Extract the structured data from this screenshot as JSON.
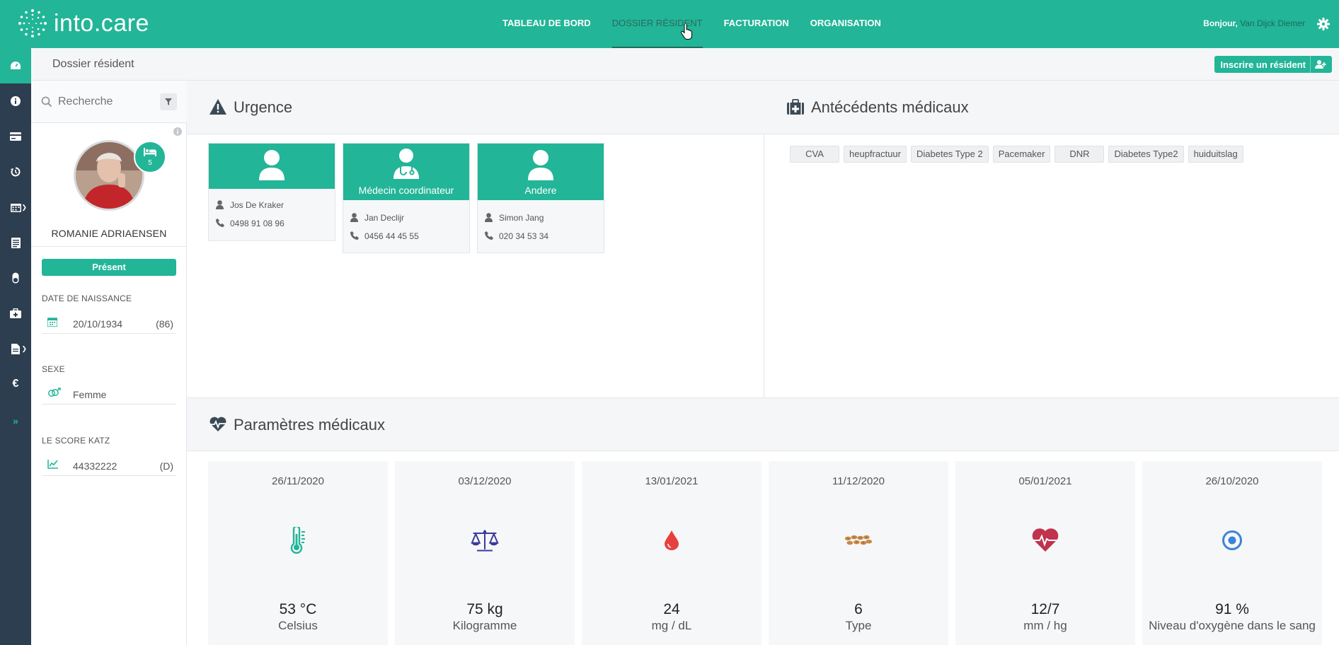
{
  "app": {
    "brand": "into.care"
  },
  "nav": {
    "items": [
      {
        "label": "TABLEAU DE BORD"
      },
      {
        "label": "DOSSIER RÉSIDENT"
      },
      {
        "label": "FACTURATION"
      },
      {
        "label": "ORGANISATION"
      }
    ],
    "greeting": "Bonjour,",
    "user": "Van Dijck Diemer"
  },
  "breadcrumb": {
    "title": "Dossier résident"
  },
  "enroll_button": {
    "label": "Inscrire un résident"
  },
  "search": {
    "placeholder": "Recherche"
  },
  "resident": {
    "bed": "5",
    "name": "ROMANIE ADRIAENSEN",
    "status": "Présent",
    "birth_label": "DATE DE NAISSANCE",
    "birth_date": "20/10/1934",
    "age": "(86)",
    "sex_label": "SEXE",
    "sex": "Femme",
    "katz_label": "LE SCORE KATZ",
    "katz_score": "44332222",
    "katz_class": "(D)"
  },
  "urgence": {
    "title": "Urgence",
    "contacts": [
      {
        "role": "",
        "name": "Jos De Kraker",
        "phone": "0498 91 08 96"
      },
      {
        "role": "Médecin coordinateur",
        "name": "Jan Declijr",
        "phone": "0456 44 45 55"
      },
      {
        "role": "Andere",
        "name": "Simon Jang",
        "phone": "020 34 53 34"
      }
    ]
  },
  "antecedents": {
    "title": "Antécédents médicaux",
    "tags": [
      "CVA",
      "heupfractuur",
      "Diabetes Type 2",
      "Pacemaker",
      "DNR",
      "Diabetes Type2",
      "huiduitslag"
    ]
  },
  "parametres": {
    "title": "Paramètres médicaux",
    "cards": [
      {
        "date": "26/11/2020",
        "value": "53 °C",
        "unit": "Celsius",
        "icon": "thermometer-icon",
        "color": "#22b597"
      },
      {
        "date": "03/12/2020",
        "value": "75 kg",
        "unit": "Kilogramme",
        "icon": "scale-icon",
        "color": "#3a3a9a"
      },
      {
        "date": "13/01/2021",
        "value": "24",
        "unit": "mg / dL",
        "icon": "blood-drop-icon",
        "color": "#e8403e"
      },
      {
        "date": "11/12/2020",
        "value": "6",
        "unit": "Type",
        "icon": "stool-icon",
        "color": "#c8894a"
      },
      {
        "date": "05/01/2021",
        "value": "12/7",
        "unit": "mm / hg",
        "icon": "heart-pulse-icon",
        "color": "#c0334d"
      },
      {
        "date": "26/10/2020",
        "value": "91 %",
        "unit": "Niveau d'oxygène dans le sang",
        "icon": "oxygen-icon",
        "color": "#3b84d6"
      }
    ]
  },
  "colors": {
    "primary": "#22b597",
    "sidebar": "#2c3e50"
  }
}
